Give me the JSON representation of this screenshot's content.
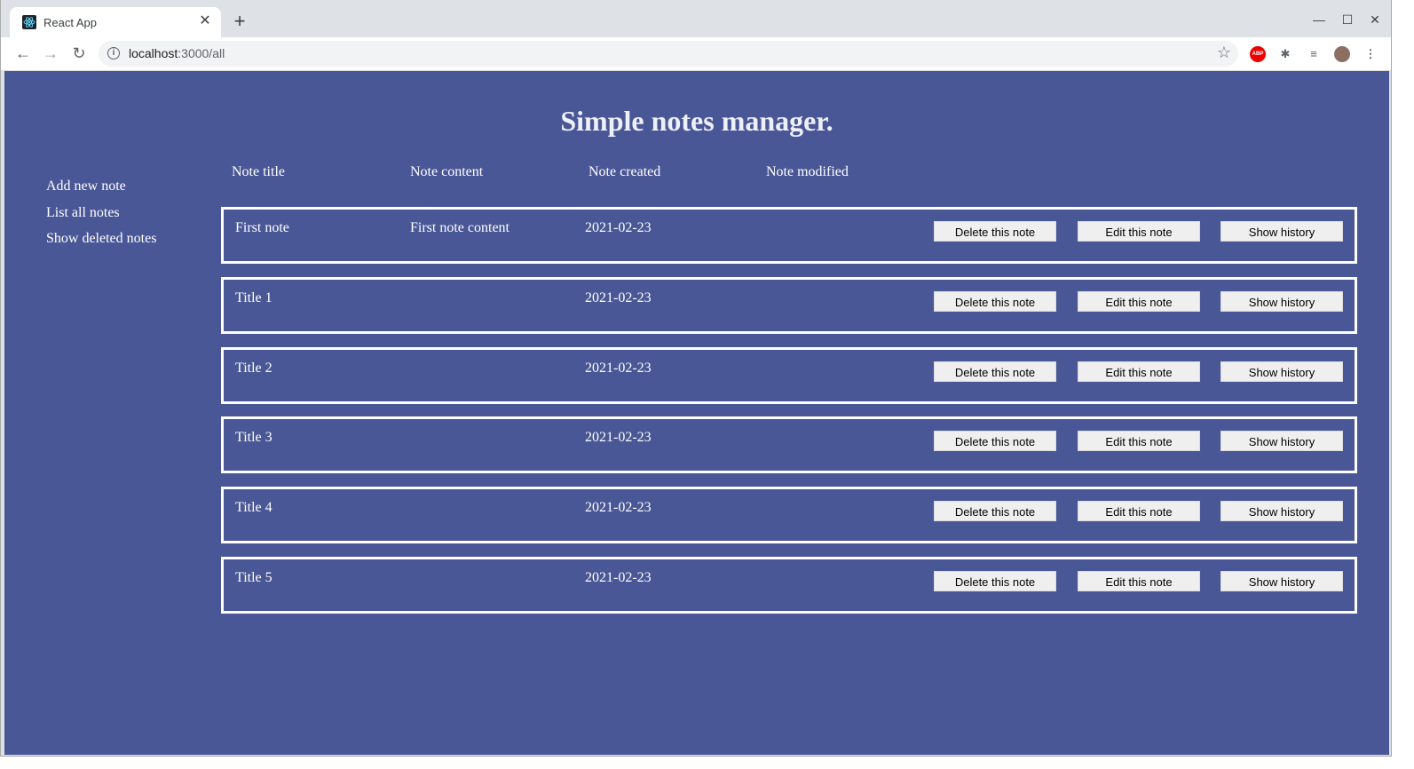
{
  "browser": {
    "tab_title": "React App",
    "url_host": "localhost",
    "url_rest": ":3000/all",
    "extensions": [
      "star-icon",
      "adblock-icon",
      "puzzle-icon",
      "playlist-icon",
      "avatar",
      "menu-icon"
    ],
    "abp_label": "ABP"
  },
  "app": {
    "title": "Simple notes manager.",
    "background_color": "#4a5796",
    "sidebar": {
      "items": [
        {
          "label": "Add new note"
        },
        {
          "label": "List all notes"
        },
        {
          "label": "Show deleted notes"
        }
      ]
    },
    "columns": [
      "Note title",
      "Note content",
      "Note created",
      "Note modified"
    ],
    "buttons": {
      "delete": "Delete this note",
      "edit": "Edit this note",
      "history": "Show history"
    },
    "notes": [
      {
        "title": "First note",
        "content": "First note content",
        "created": "2021-02-23",
        "modified": ""
      },
      {
        "title": "Title 1",
        "content": "",
        "created": "2021-02-23",
        "modified": ""
      },
      {
        "title": "Title 2",
        "content": "",
        "created": "2021-02-23",
        "modified": ""
      },
      {
        "title": "Title 3",
        "content": "",
        "created": "2021-02-23",
        "modified": ""
      },
      {
        "title": "Title 4",
        "content": "",
        "created": "2021-02-23",
        "modified": ""
      },
      {
        "title": "Title 5",
        "content": "",
        "created": "2021-02-23",
        "modified": ""
      }
    ]
  }
}
